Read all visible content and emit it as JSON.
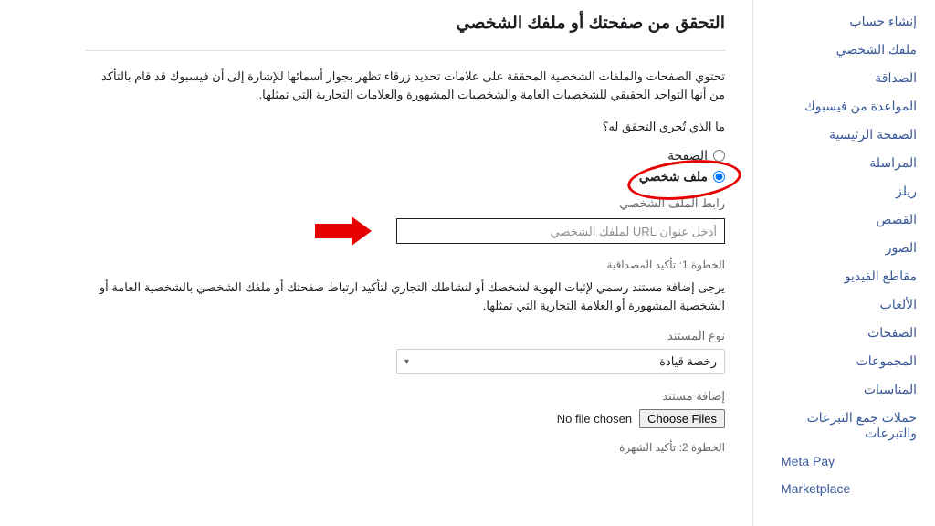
{
  "sidebar": {
    "items": [
      "إنشاء حساب",
      "ملفك الشخصي",
      "الصداقة",
      "المواعدة من فيسبوك",
      "الصفحة الرئيسية",
      "المراسلة",
      "ريلز",
      "القصص",
      "الصور",
      "مقاطع الفيديو",
      "الألعاب",
      "الصفحات",
      "المجموعات",
      "المناسبات",
      "حملات جمع التبرعات والتبرعات"
    ],
    "items_ltr": [
      "Meta Pay",
      "Marketplace"
    ]
  },
  "main": {
    "title": "التحقق من صفحتك أو ملفك الشخصي",
    "intro": "تحتوي الصفحات والملفات الشخصية المحققة على علامات تحديد زرقاء تظهر بجوار أسمائها للإشارة إلى أن فيسبوك قد قام بالتأكد من أنها التواجد الحقيقي للشخصيات العامة والشخصيات المشهورة والعلامات التجارية التي تمثلها.",
    "question": "ما الذي تُجري التحقق له؟",
    "radio_page": "الصفحة",
    "radio_profile": "ملف شخصي",
    "profile_link_label": "رابط الملف الشخصي",
    "url_placeholder": "أدخل عنوان URL لملفك الشخصي",
    "step1": "الخطوة 1: تأكيد المصداقية",
    "step1_desc": "يرجى إضافة مستند رسمي لإثبات الهوية لشخصك أو لنشاطك التجاري لتأكيد ارتباط صفحتك أو ملفك الشخصي بالشخصية العامة أو الشخصية المشهورة أو العلامة التجارية التي تمثلها.",
    "doctype_label": "نوع المستند",
    "doctype_value": "رخصة قيادة",
    "add_doc_label": "إضافة مستند",
    "choose_files_btn": "Choose Files",
    "no_file_text": "No file chosen",
    "step2": "الخطوة 2: تأكيد الشهرة"
  }
}
